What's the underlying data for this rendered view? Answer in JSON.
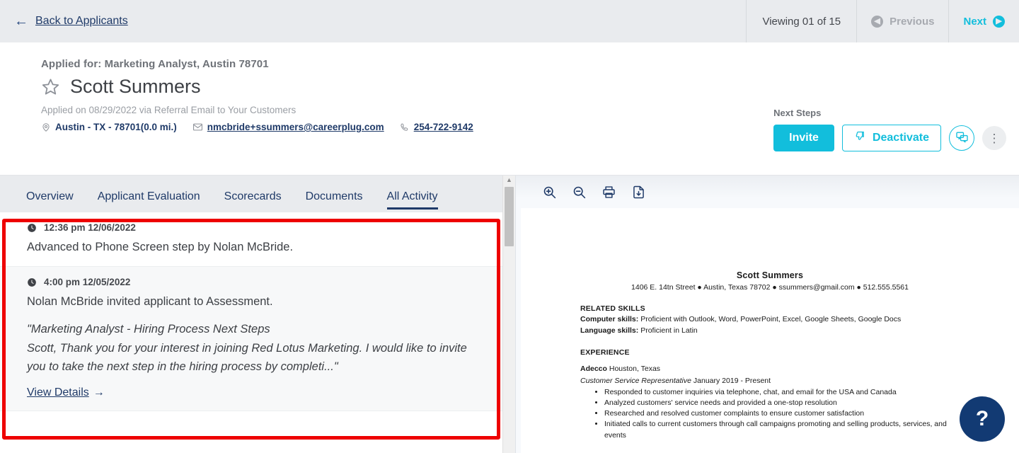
{
  "topbar": {
    "back_label": "Back to Applicants",
    "viewing_label": "Viewing 01 of 15",
    "previous_label": "Previous",
    "next_label": "Next"
  },
  "applicant": {
    "applied_for": "Applied for: Marketing Analyst, Austin 78701",
    "name": "Scott Summers",
    "applied_on": "Applied on 08/29/2022 via Referral Email to Your Customers",
    "location": "Austin - TX - 78701(0.0 mi.)",
    "email": "nmcbride+ssummers@careerplug.com",
    "phone": "254-722-9142"
  },
  "next_steps": {
    "label": "Next Steps",
    "invite_label": "Invite",
    "deactivate_label": "Deactivate",
    "more_label": "⋮"
  },
  "tabs": [
    {
      "label": "Overview",
      "active": false
    },
    {
      "label": "Applicant Evaluation",
      "active": false
    },
    {
      "label": "Scorecards",
      "active": false
    },
    {
      "label": "Documents",
      "active": false
    },
    {
      "label": "All Activity",
      "active": true
    }
  ],
  "activity": [
    {
      "time": "12:36 pm 12/06/2022",
      "text": "Advanced to Phone Screen step by Nolan McBride."
    },
    {
      "time": "4:00 pm 12/05/2022",
      "text": "Nolan McBride invited applicant to Assessment.",
      "quote_line1": "\"Marketing Analyst - Hiring Process Next Steps",
      "quote_line2": "Scott, Thank you for your interest in joining Red Lotus Marketing. I would like to invite you to take the next step in the hiring process by completi...\"",
      "view_details_label": "View Details"
    }
  ],
  "document": {
    "toolbar": {
      "zoom_in": "zoom-in",
      "zoom_out": "zoom-out",
      "print": "print",
      "download": "download"
    },
    "resume": {
      "name": "Scott Summers",
      "contact": "1406 E. 14tn Street ● Austin, Texas 78702 ● ssummers@gmail.com ● 512.555.5561",
      "skills_heading": "RELATED SKILLS",
      "computer_skills_label": "Computer skills:",
      "computer_skills_value": " Proficient with Outlook, Word, PowerPoint, Excel, Google Sheets, Google Docs",
      "language_skills_label": "Language skills:",
      "language_skills_value": " Proficient in Latin",
      "experience_heading": "EXPERIENCE",
      "employer": "Adecco",
      "employer_location": " Houston, Texas",
      "job_title": "Customer Service Representative",
      "job_dates": " January 2019 - Present",
      "bullets": [
        "Responded to customer inquiries via telephone, chat, and email for the USA and Canada",
        "Analyzed customers' service needs and provided a one-stop resolution",
        "Researched and resolved customer complaints to ensure customer satisfaction",
        "Initiated calls to current customers through call campaigns promoting and selling products, services, and events"
      ]
    }
  },
  "help": {
    "label": "?"
  },
  "colors": {
    "accent_cyan": "#12bedc",
    "navy": "#1f3a68",
    "highlight_red": "#ee0000",
    "help_navy": "#123a73"
  }
}
